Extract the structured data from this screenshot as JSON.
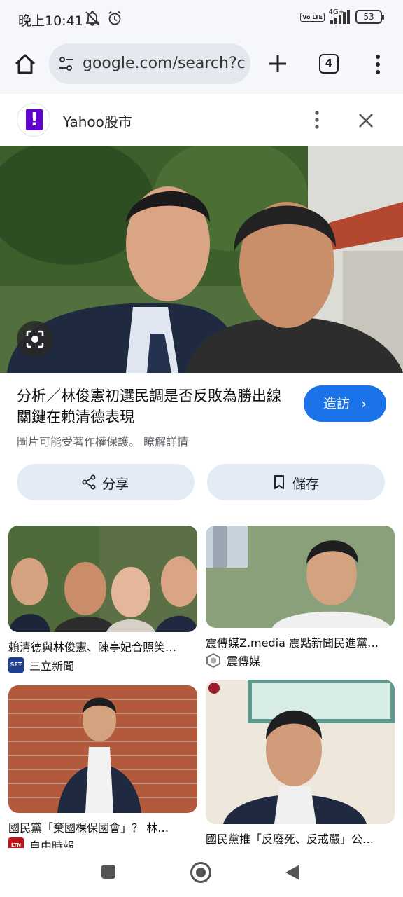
{
  "status": {
    "time": "晚上10:41",
    "network": "4G+",
    "volte": "Vo LTE",
    "battery": "53"
  },
  "toolbar": {
    "url": "google.com/search?c",
    "tab_count": "4"
  },
  "header": {
    "source_title": "Yahoo股市"
  },
  "article": {
    "title": "分析／林俊憲初選民調是否反敗為勝出線關鍵在賴清德表現",
    "visit_label": "造訪",
    "copyright_note": "圖片可能受著作權保護。 瞭解詳情"
  },
  "actions": {
    "share_label": "分享",
    "save_label": "儲存"
  },
  "results": [
    {
      "caption": "賴清德與林俊憲、陳亭妃合照笑…",
      "source": "三立新聞",
      "source_logo": "SET"
    },
    {
      "caption": "震傳媒Z.media 震點新聞民進黨…",
      "source": "震傳媒",
      "source_logo": ""
    },
    {
      "caption": "國民黨「棄國棵保國會」？ 林…",
      "source": "自由時報",
      "source_logo": "LTN"
    },
    {
      "caption": "國民黨推「反廢死、反戒嚴」公…",
      "source": "",
      "source_logo": ""
    }
  ],
  "icons": {
    "home": "home-icon",
    "tune": "tune-icon",
    "add": "plus-icon",
    "menu": "more-vert-icon",
    "close": "close-icon",
    "lens": "google-lens-icon",
    "share": "share-icon",
    "bookmark": "bookmark-icon"
  },
  "colors": {
    "accent": "#1a73e8",
    "action_bg": "#e3ebf7",
    "yahoo_purple": "#6001d2"
  }
}
